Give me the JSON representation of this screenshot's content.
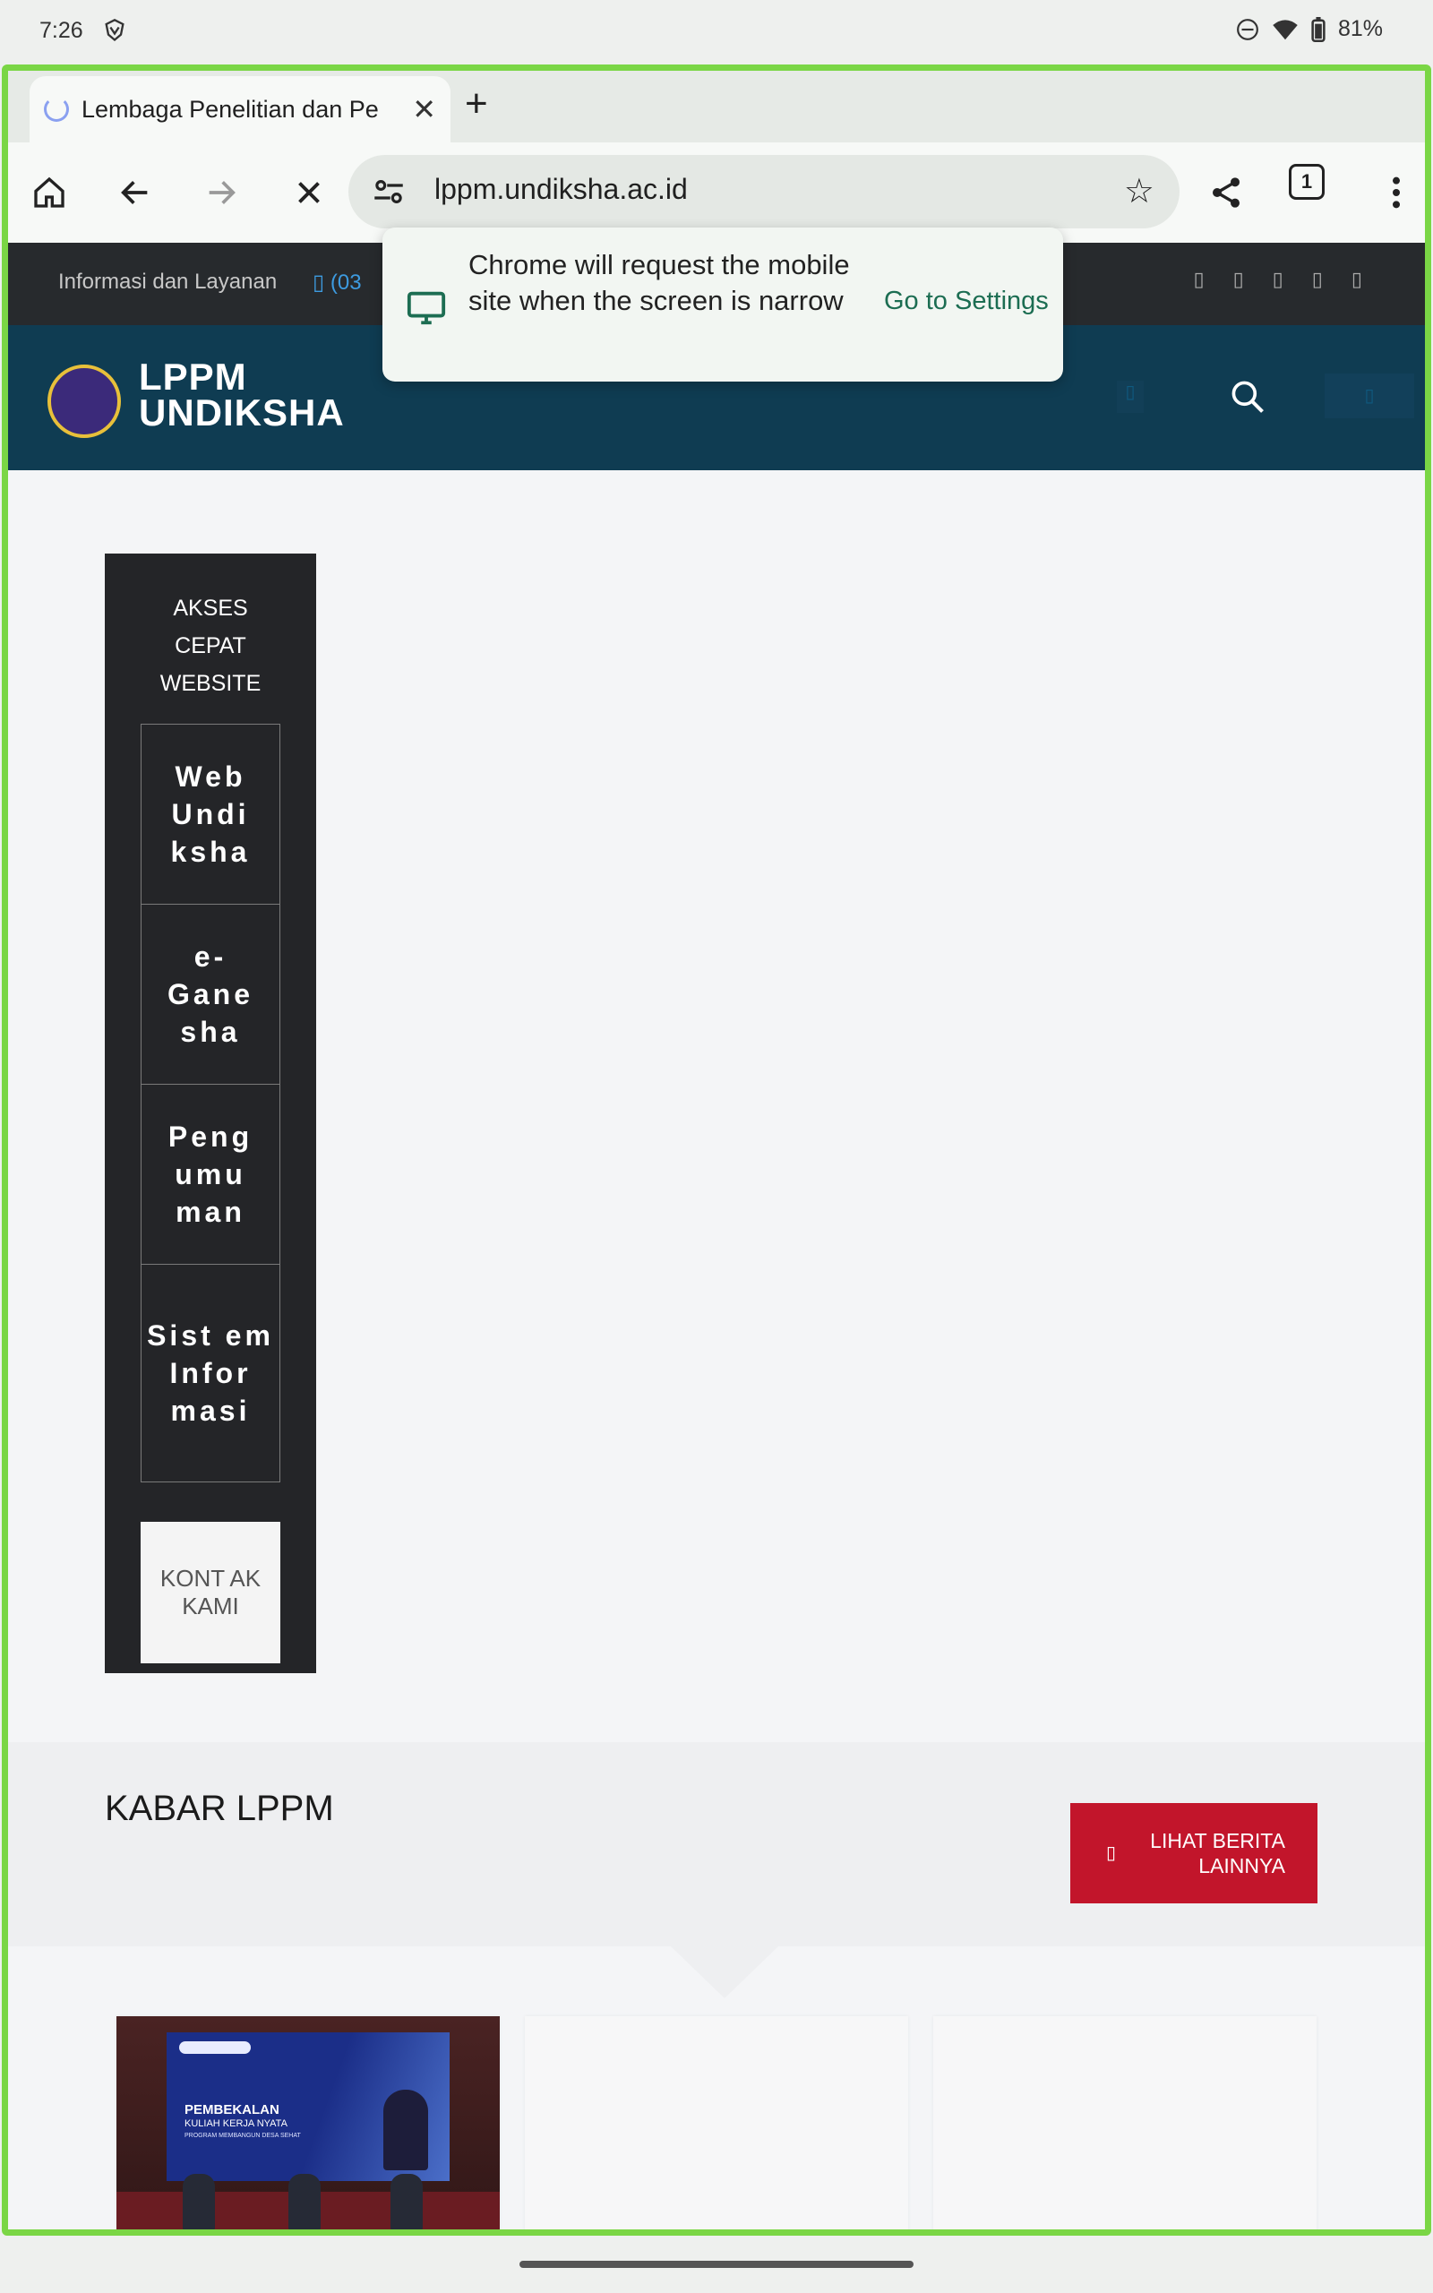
{
  "status": {
    "time": "7:26",
    "battery": "81%"
  },
  "browser": {
    "tab_title": "Lembaga Penelitian dan Pe",
    "url": "lppm.undiksha.ac.id",
    "tab_count": "1"
  },
  "popup": {
    "message": "Chrome will request the mobile site when the screen is narrow",
    "action": "Go to Settings"
  },
  "topinfo": {
    "label": "Informasi dan Layanan",
    "phone": "(03"
  },
  "header": {
    "logo_line1": "LPPM",
    "logo_line2": "UNDIKSHA"
  },
  "quick_access": {
    "title_lines": [
      "AKSES",
      "CEPAT",
      "WEBSITE"
    ],
    "items": [
      {
        "label": "Web Undi ksha"
      },
      {
        "label": "e- Gane sha"
      },
      {
        "label": "Peng umu man"
      },
      {
        "label": "Sist em Infor masi"
      }
    ],
    "contact_label": "KONT AK KAMI"
  },
  "kabar": {
    "title": "KABAR LPPM",
    "button_label": "LIHAT BERITA LAINNYA"
  },
  "news_card": {
    "screen_title": "PEMBEKALAN",
    "screen_subtitle": "KULIAH KERJA NYATA",
    "screen_line": "PROGRAM MEMBANGUN DESA SEHAT"
  }
}
